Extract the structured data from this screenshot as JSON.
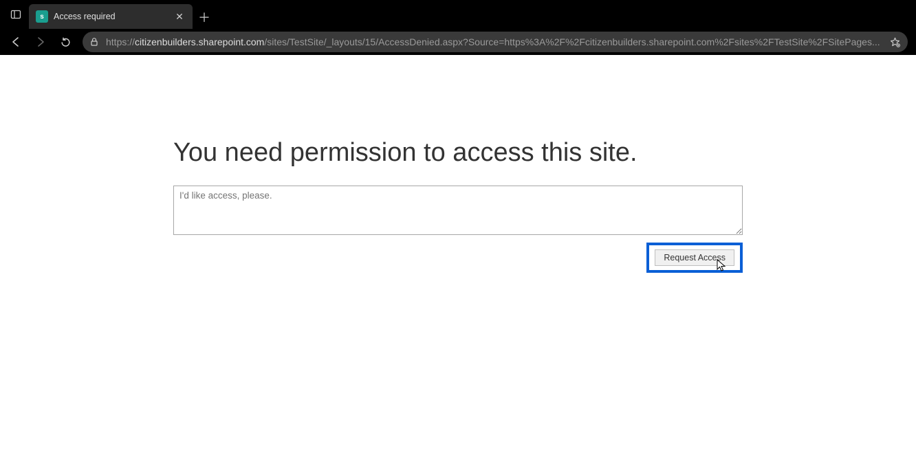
{
  "browser": {
    "tab": {
      "favicon_letter": "s",
      "title": "Access required"
    },
    "url_protocol": "https://",
    "url_host": "citizenbuilders.sharepoint.com",
    "url_path": "/sites/TestSite/_layouts/15/AccessDenied.aspx?Source=https%3A%2F%2Fcitizenbuilders.sharepoint.com%2Fsites%2FTestSite%2FSitePages..."
  },
  "page": {
    "heading": "You need permission to access this site.",
    "message_placeholder": "I'd like access, please.",
    "request_button": "Request Access"
  }
}
